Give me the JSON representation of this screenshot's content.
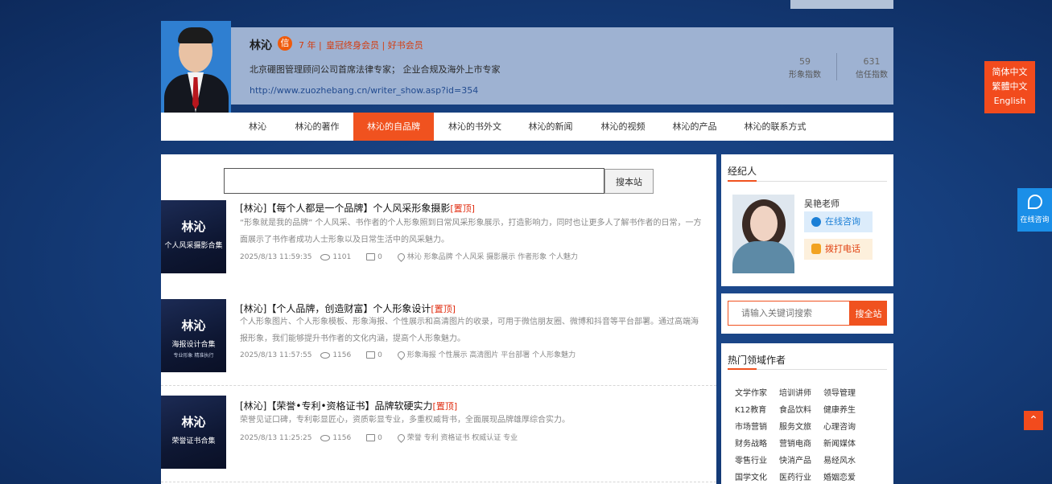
{
  "profile": {
    "name": "林沁",
    "badge": "信",
    "years": "7 年 |",
    "membership": "皇冠终身会员 | 好书会员",
    "description": "北京硼图管理顾问公司首席法律专家；  企业合规及海外上市专家",
    "url": "http://www.zuozhebang.cn/writer_show.asp?id=354",
    "stats": [
      {
        "value": "59",
        "label": "形象指数"
      },
      {
        "value": "631",
        "label": "信任指数"
      }
    ]
  },
  "nav": {
    "items": [
      {
        "label": "林沁"
      },
      {
        "label": "林沁的著作"
      },
      {
        "label": "林沁的自品牌"
      },
      {
        "label": "林沁的书外文"
      },
      {
        "label": "林沁的新闻"
      },
      {
        "label": "林沁的视频"
      },
      {
        "label": "林沁的产品"
      },
      {
        "label": "林沁的联系方式"
      }
    ],
    "active_index": 2
  },
  "language": {
    "items": [
      "简体中文",
      "繁體中文",
      "English"
    ]
  },
  "consult": {
    "label": "在线咨询"
  },
  "search": {
    "button": "搜本站"
  },
  "articles": [
    {
      "thumb_title": "林沁",
      "thumb_subtitle": "个人风采摄影合集",
      "thumb_caption": "",
      "title": "[林沁]【每个人都是一个品牌】个人风采形象摄影",
      "tag": "[置顶]",
      "summary": "“形象就是我的品牌” 个人风采、书作者的个人形象照到日常风采形象展示，打造影响力，同时也让更多人了解书作者的日常，一方面展示了书作者成功人士形象以及日常生活中的风采魅力。",
      "date": "2025/8/13 11:59:35",
      "views": "1101",
      "comments": "0",
      "tags": "林沁  形象品牌  个人风采  摄影展示  作者形象  个人魅力"
    },
    {
      "thumb_title": "林沁",
      "thumb_subtitle": "海报设计合集",
      "thumb_caption": "专业形象  精准执行",
      "title": "[林沁]【个人品牌，创造财富】个人形象设计",
      "tag": "[置顶]",
      "summary": "个人形象图片、个人形象模板、形象海报、个性展示和高清图片的收录，可用于微信朋友圈、微博和抖音等平台部署。通过高端海报形象，我们能够提升书作者的文化内涵，提高个人形象魅力。",
      "date": "2025/8/13 11:57:55",
      "views": "1156",
      "comments": "0",
      "tags": "形象海报  个性展示  高清图片  平台部署  个人形象魅力"
    },
    {
      "thumb_title": "林沁",
      "thumb_subtitle": "荣誉证书合集",
      "thumb_caption": "",
      "title": "[林沁]【荣誉•专利•资格证书】品牌软硬实力",
      "tag": "[置顶]",
      "summary": "荣誉见证口碑，专利彰显匠心，资质彰显专业，多重权威背书，全面展现品牌雄厚综合实力。",
      "date": "2025/8/13 11:25:25",
      "views": "1156",
      "comments": "0",
      "tags": "荣誉  专利  资格证书  权威认证  专业"
    }
  ],
  "agent": {
    "heading": "经纪人",
    "name": "吴艳老师",
    "online_label": "在线咨询",
    "call_label": "拨打电话"
  },
  "keyword_search": {
    "placeholder": "请输入关键词搜索",
    "button": "搜全站"
  },
  "hot": {
    "heading": "热门领域作者",
    "items": [
      "文学作家",
      "培训讲师",
      "领导管理",
      "K12教育",
      "食品饮料",
      "健康养生",
      "市场营销",
      "服务文旅",
      "心理咨询",
      "财务战略",
      "营销电商",
      "新闻媒体",
      "零售行业",
      "快消产品",
      "易经风水",
      "国学文化",
      "医药行业",
      "婚姻恋爱"
    ]
  }
}
